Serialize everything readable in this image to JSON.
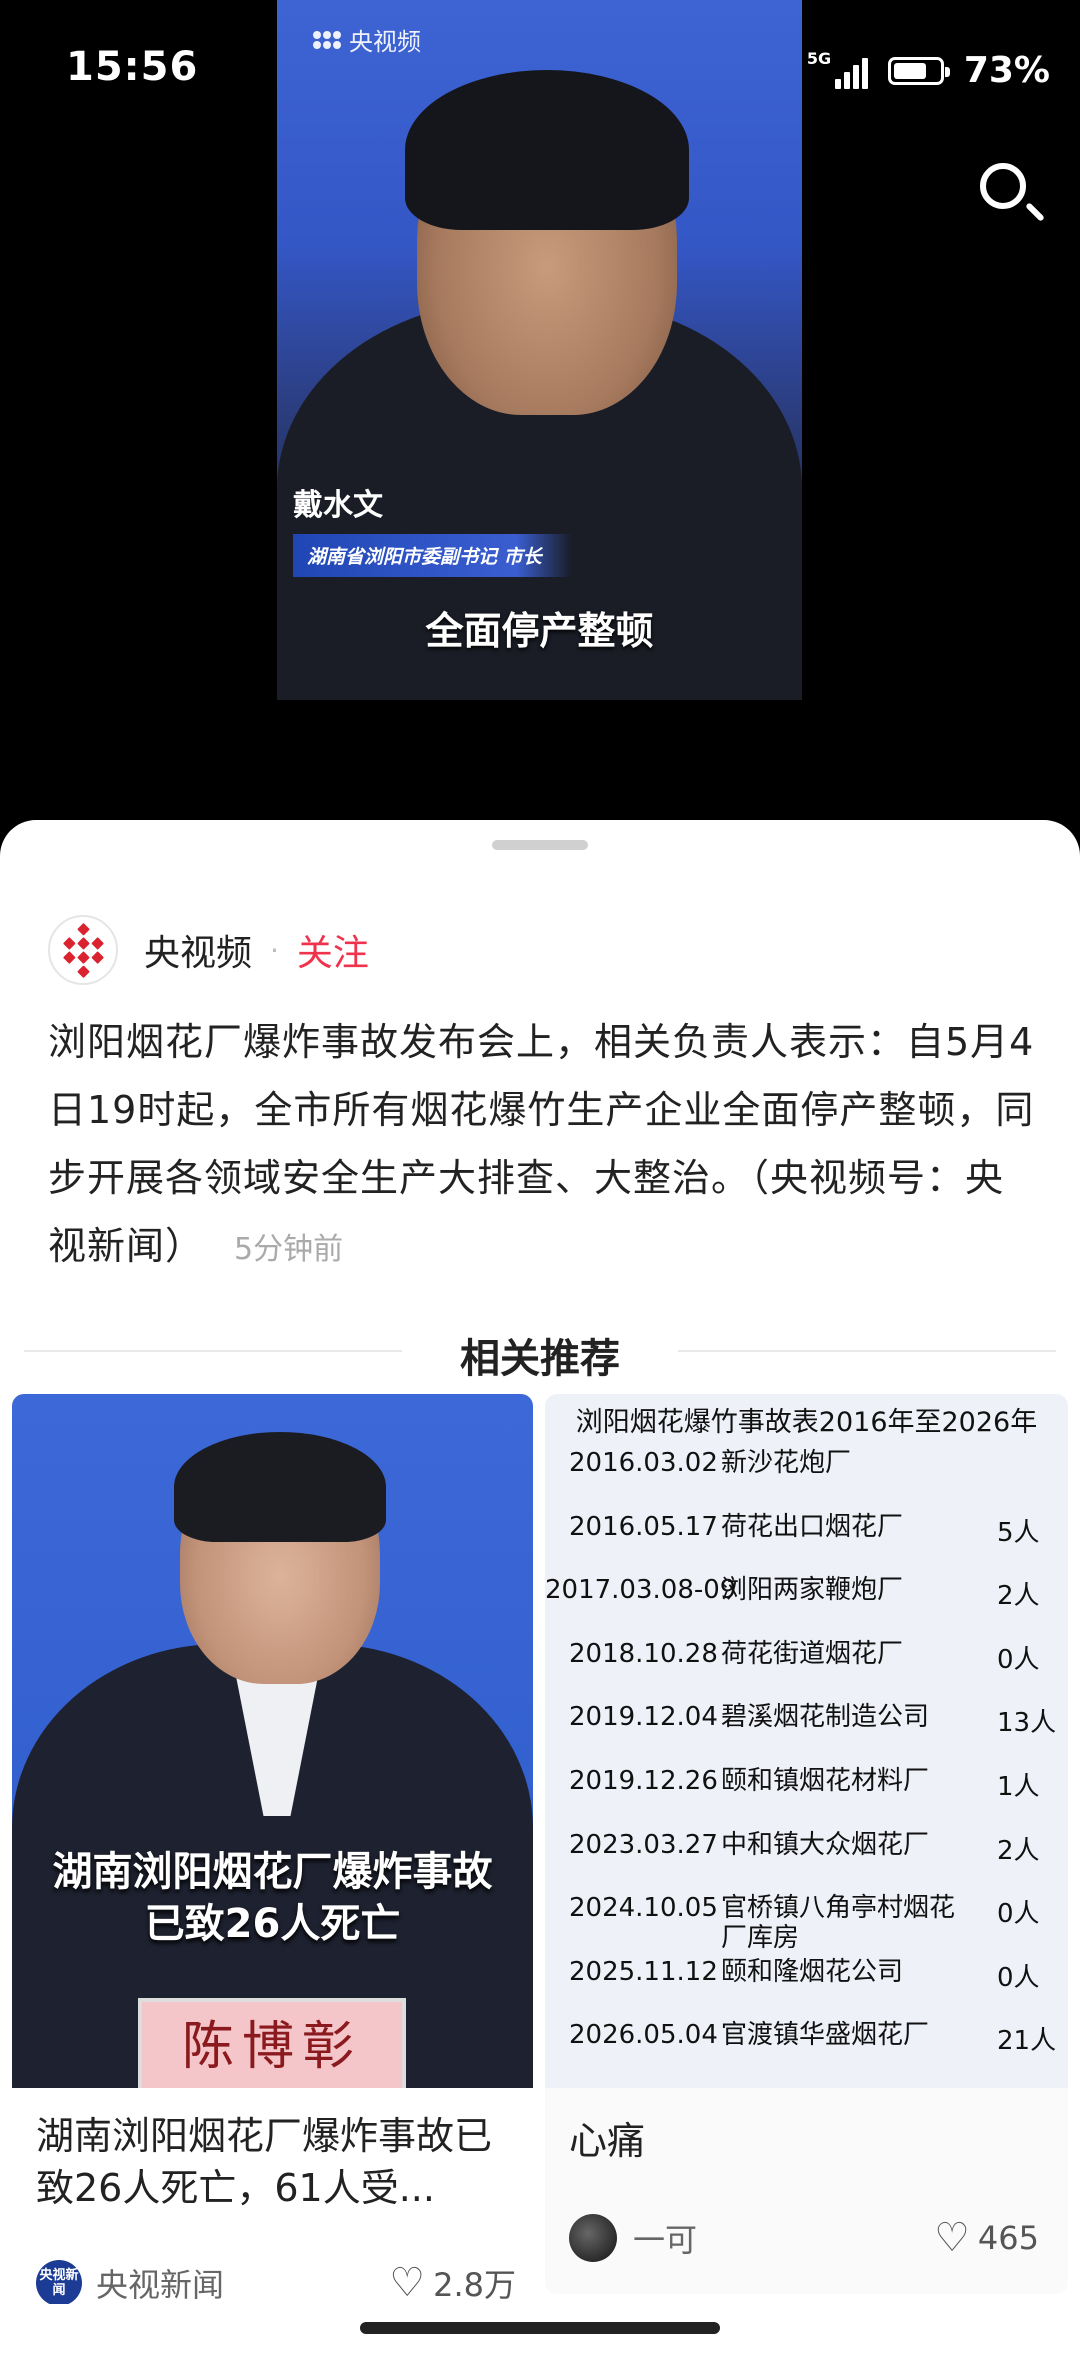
{
  "status": {
    "time": "15:56",
    "battery": "73%",
    "battery_level": 0.73,
    "net1": "5G",
    "net2": "5G"
  },
  "video": {
    "logo": "央视频",
    "person_name": "戴水文",
    "person_title": "湖南省浏阳市委副书记 市长",
    "subtitle": "全面停产整顿"
  },
  "post": {
    "author": "央视频",
    "follow_label": "关注",
    "text": "浏阳烟花厂爆炸事故发布会上，相关负责人表示：自5月4日19时起，全市所有烟花爆竹生产企业全面停产整顿，同步开展各领域安全生产大排查、大整治。（央视频号：央视新闻）",
    "time_ago": "5分钟前"
  },
  "related": {
    "heading": "相关推荐",
    "card1": {
      "thumb_caption_line1": "湖南浏阳烟花厂爆炸事故",
      "thumb_caption_line2": "已致26人死亡",
      "nameplate": "陈博彰",
      "title": "湖南浏阳烟花厂爆炸事故已致26人死亡，61人受...",
      "source": "央视新闻",
      "source_icon_text": "央视新闻",
      "likes": "2.8万"
    },
    "card2": {
      "table_title": "浏阳烟花爆竹事故表2016年至2026年",
      "rows": [
        [
          "2016.03.02",
          "新沙花炮厂",
          ""
        ],
        [
          "2016.05.17",
          "荷花出口烟花厂",
          "5人"
        ],
        [
          "2017.03.08-09",
          "浏阳两家鞭炮厂",
          "2人"
        ],
        [
          "2018.10.28",
          "荷花街道烟花厂",
          "0人"
        ],
        [
          "2019.12.04",
          "碧溪烟花制造公司",
          "13人"
        ],
        [
          "2019.12.26",
          "颐和镇烟花材料厂",
          "1人"
        ],
        [
          "2023.03.27",
          "中和镇大众烟花厂",
          "2人"
        ],
        [
          "2024.10.05",
          "官桥镇八角亭村烟花厂库房",
          "0人"
        ],
        [
          "2025.11.12",
          "颐和隆烟花公司",
          "0人"
        ],
        [
          "2026.05.04",
          "官渡镇华盛烟花厂",
          "21人"
        ]
      ],
      "title": "心痛",
      "user": "一可",
      "likes": "465"
    }
  }
}
